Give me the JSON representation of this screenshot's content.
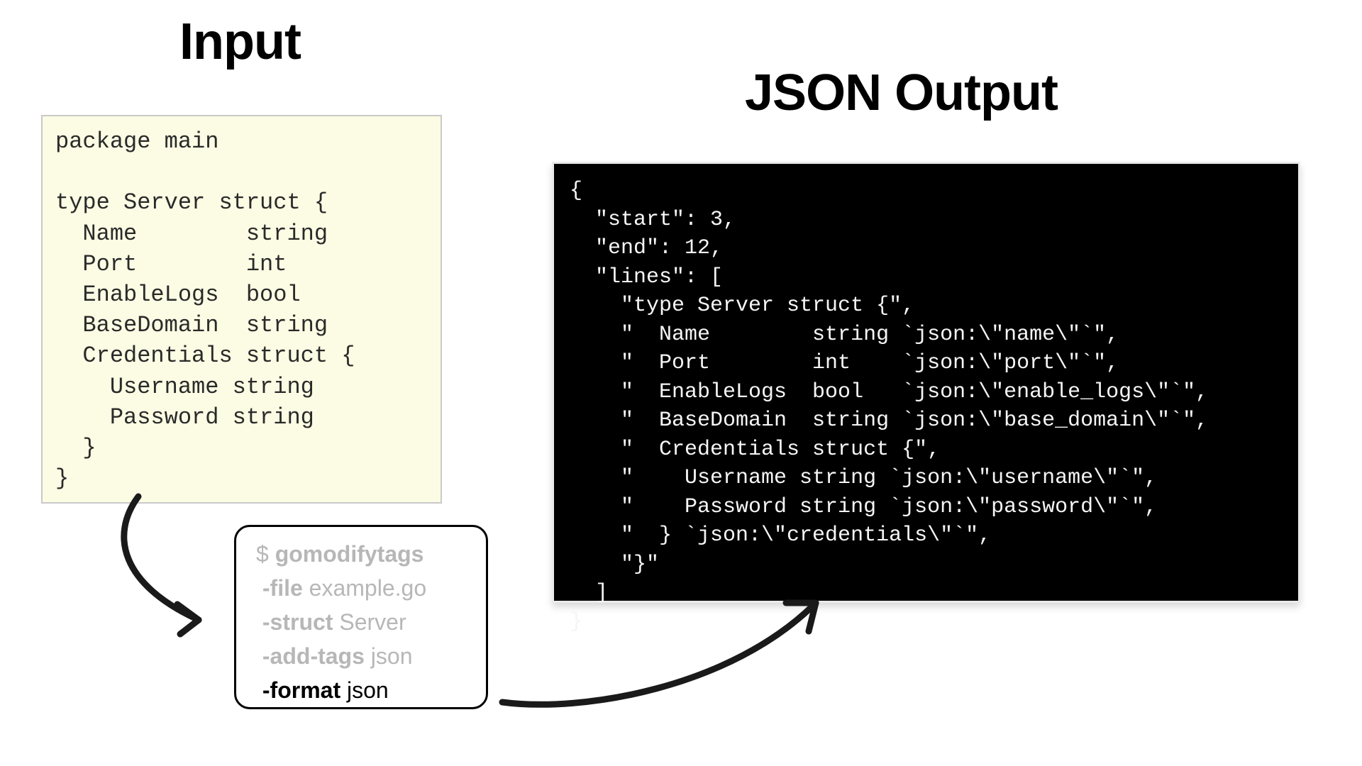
{
  "headings": {
    "input": "Input",
    "output": "JSON Output"
  },
  "input_code": "package main\n\ntype Server struct {\n  Name        string\n  Port        int\n  EnableLogs  bool\n  BaseDomain  string\n  Credentials struct {\n    Username string\n    Password string\n  }\n}",
  "output_code": "{\n  \"start\": 3,\n  \"end\": 12,\n  \"lines\": [\n    \"type Server struct {\",\n    \"  Name        string `json:\\\"name\\\"`\",\n    \"  Port        int    `json:\\\"port\\\"`\",\n    \"  EnableLogs  bool   `json:\\\"enable_logs\\\"`\",\n    \"  BaseDomain  string `json:\\\"base_domain\\\"`\",\n    \"  Credentials struct {\",\n    \"    Username string `json:\\\"username\\\"`\",\n    \"    Password string `json:\\\"password\\\"`\",\n    \"  } `json:\\\"credentials\\\"`\",\n    \"}\"\n  ]\n}",
  "command": {
    "prompt": "$ ",
    "bin": "gomodifytags",
    "flags": [
      {
        "flag": "-file",
        "value": "example.go",
        "highlight": false
      },
      {
        "flag": "-struct",
        "value": "Server",
        "highlight": false
      },
      {
        "flag": "-add-tags",
        "value": "json",
        "highlight": false
      },
      {
        "flag": "-format",
        "value": "json",
        "highlight": true
      }
    ]
  }
}
